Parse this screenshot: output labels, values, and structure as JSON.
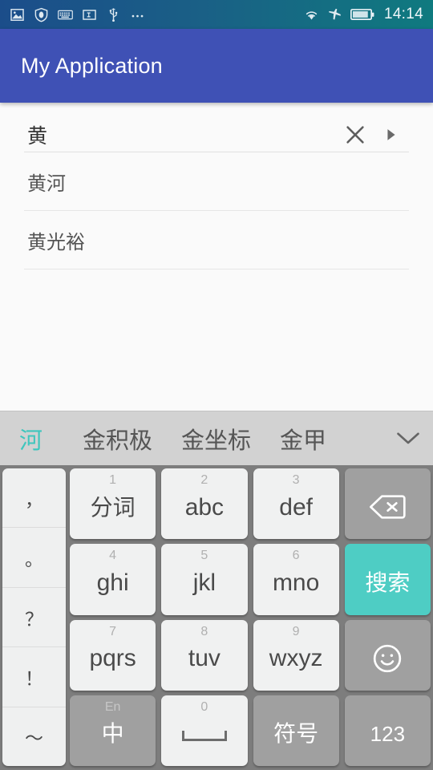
{
  "status_bar": {
    "icons": [
      "image-icon",
      "shield-icon",
      "keyboard-icon",
      "textfield-icon",
      "usb-icon",
      "more-icon"
    ],
    "right_icons": [
      "wifi-icon",
      "airplane-mode-icon",
      "battery-icon"
    ],
    "time": "14:14"
  },
  "app_bar": {
    "title": "My Application",
    "color": "#3f51b5"
  },
  "search": {
    "value": "黄",
    "placeholder": "",
    "clear_icon": "close-icon",
    "submit_icon": "play-arrow-icon"
  },
  "suggestions": [
    {
      "label": "黄河"
    },
    {
      "label": "黄光裕"
    }
  ],
  "ime": {
    "candidates": [
      {
        "label": "河",
        "selected": true
      },
      {
        "label": "金积极",
        "selected": false
      },
      {
        "label": "金坐标",
        "selected": false
      },
      {
        "label": "金甲",
        "selected": false
      }
    ],
    "expand_icon": "chevron-down-icon",
    "accent_color": "#4ecdc4",
    "punctuation_keys": [
      "，",
      "。",
      "？",
      "！",
      "～"
    ],
    "keys": [
      {
        "num": "1",
        "main": "分词",
        "style": "light",
        "cjk": true
      },
      {
        "num": "2",
        "main": "abc",
        "style": "light"
      },
      {
        "num": "3",
        "main": "def",
        "style": "light"
      },
      {
        "num": "",
        "main": "",
        "style": "dark",
        "icon": "backspace-icon"
      },
      {
        "num": "4",
        "main": "ghi",
        "style": "light"
      },
      {
        "num": "5",
        "main": "jkl",
        "style": "light"
      },
      {
        "num": "6",
        "main": "mno",
        "style": "light"
      },
      {
        "num": "",
        "main": "搜索",
        "style": "accent",
        "cjk": true
      },
      {
        "num": "7",
        "main": "pqrs",
        "style": "light"
      },
      {
        "num": "8",
        "main": "tuv",
        "style": "light"
      },
      {
        "num": "9",
        "main": "wxyz",
        "style": "light"
      },
      {
        "num": "",
        "main": "",
        "style": "dark",
        "icon": "emoji-icon"
      },
      {
        "num": "En",
        "main": "中",
        "style": "dark",
        "cjk": true
      },
      {
        "num": "0",
        "main": "",
        "style": "light",
        "icon": "spacebar-icon"
      },
      {
        "num": "",
        "main": "符号",
        "style": "dark",
        "cjk": true
      },
      {
        "num": "",
        "main": "123",
        "style": "dark",
        "sm": true
      }
    ]
  }
}
